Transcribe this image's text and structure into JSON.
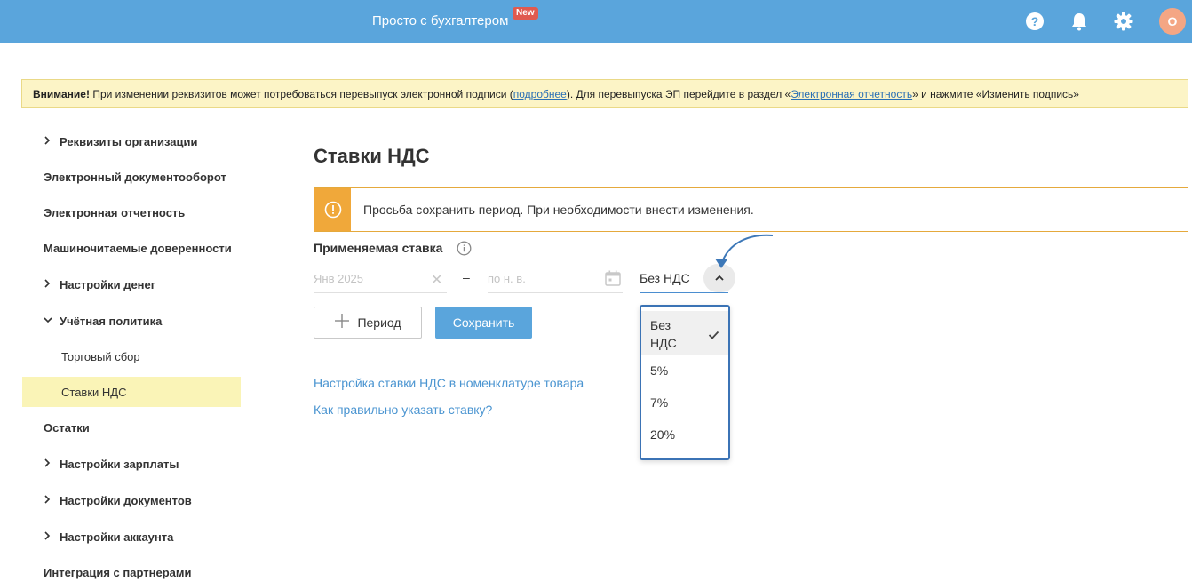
{
  "header": {
    "brand": "Просто с бухгалтером",
    "badge": "New",
    "avatar_letter": "О",
    "icons": [
      "help-icon",
      "bell-icon",
      "gear-icon"
    ]
  },
  "warning": {
    "bold": "Внимание!",
    "text1": " При изменении реквизитов может потребоваться перевыпуск электронной подписи (",
    "link1": "подробнее",
    "text2": "). Для перевыпуска ЭП перейдите в раздел «",
    "link2": "Электронная отчетность",
    "text3": "» и нажмите «Изменить подпись»"
  },
  "sidebar": {
    "items": [
      {
        "label": "Реквизиты организации"
      },
      {
        "label": "Электронный документооборот"
      },
      {
        "label": "Электронная отчетность"
      },
      {
        "label": "Машиночитаемые доверенности"
      },
      {
        "label": "Настройки денег"
      },
      {
        "label": "Учётная политика"
      },
      {
        "label": "Торговый сбор"
      },
      {
        "label": "Ставки НДС"
      },
      {
        "label": "Остатки"
      },
      {
        "label": "Настройки зарплаты"
      },
      {
        "label": "Настройки документов"
      },
      {
        "label": "Настройки аккаунта"
      },
      {
        "label": "Интеграция с партнерами"
      }
    ]
  },
  "main": {
    "title": "Ставки НДС",
    "notice": "Просьба сохранить период. При необходимости внести изменения.",
    "rate_label": "Применяемая ставка",
    "date_from_placeholder": "Янв 2025",
    "date_to_placeholder": "по н. в.",
    "dash": "–",
    "selected_rate": "Без НДС",
    "period_button": "Период",
    "save_button": "Сохранить",
    "link1": "Настройка ставки НДС в номенклатуре товара",
    "link2": "Как правильно указать ставку?"
  },
  "dropdown": {
    "options": [
      {
        "label": "Без НДС",
        "selected": true
      },
      {
        "label": "5%"
      },
      {
        "label": "7%"
      },
      {
        "label": "20%"
      }
    ]
  },
  "colors": {
    "header_bg": "#5aa5dc",
    "accent": "#4b95d1",
    "warning_bg": "#fcf4c6",
    "notice_icon_bg": "#f0a83a",
    "active_sidebar_bg": "#faf4b7",
    "badge_bg": "#e05a4f",
    "avatar_bg": "#f4a684",
    "dropdown_border": "#3b73b5"
  }
}
